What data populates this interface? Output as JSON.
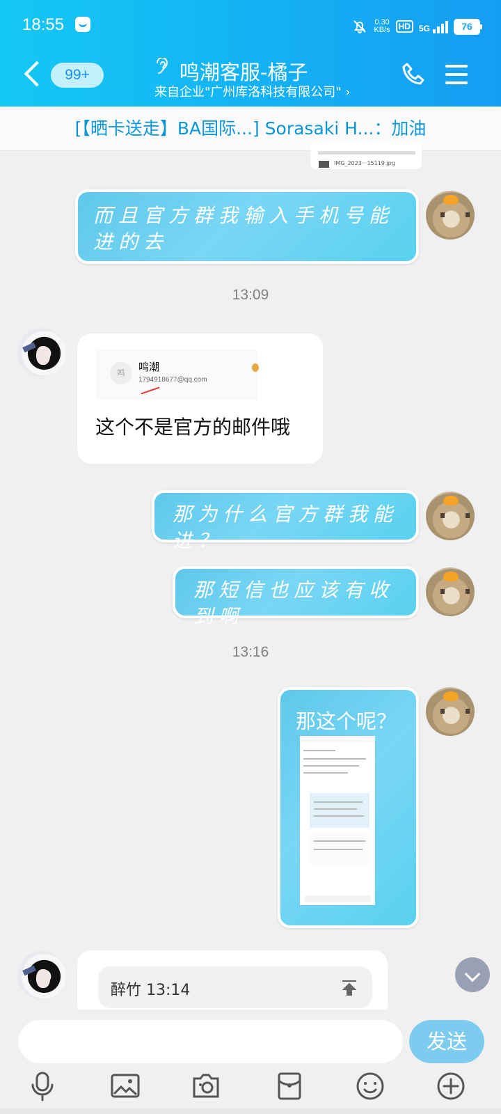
{
  "status": {
    "time": "18:55",
    "network_speed": "0.30\nKB/s",
    "hd": "HD",
    "network": "5G",
    "battery": "76"
  },
  "header": {
    "unread_count": "99+",
    "title": "鸣潮客服-橘子",
    "subtitle": "来自企业\"广州库洛科技有限公司\" ›"
  },
  "notice": {
    "text": "[【晒卡送走】BA国际...] Sorasaki H...：加油"
  },
  "partial_image": {
    "filename": "IMG_2023···15119.jpg"
  },
  "messages": [
    {
      "text": "而且官方群我输入手机号能进的去"
    },
    {
      "timestamp": "13:09"
    },
    {
      "email_preview": {
        "avatar_text": "鸣",
        "name": "鸣潮",
        "address": "1794918677@qq.com"
      },
      "text": "这个不是官方的邮件哦"
    },
    {
      "text": "那为什么官方群我能进？"
    },
    {
      "text": "那短信也应该有收到啊"
    },
    {
      "timestamp": "13:16"
    },
    {
      "text": "那这个呢？"
    },
    {
      "quote": "醉竹 13:14"
    }
  ],
  "composer": {
    "input_value": "",
    "send_label": "发送"
  },
  "icons": {
    "back": "chevron-left-icon",
    "voice": "ear-icon",
    "phone": "phone-icon",
    "menu": "menu-icon",
    "mic": "microphone-icon",
    "image": "image-icon",
    "camera": "camera-icon",
    "red_packet": "red-packet-icon",
    "emoji": "emoji-icon",
    "plus": "plus-icon",
    "scroll_down": "chevron-down-icon"
  },
  "colors": {
    "header_start": "#14c8f4",
    "header_end": "#159df3",
    "bubble_blue": "#6dd3f2",
    "send_button": "#7ecbf0"
  }
}
